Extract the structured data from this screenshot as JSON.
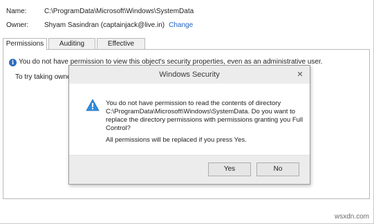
{
  "properties": {
    "name_label": "Name:",
    "name_value": "C:\\ProgramData\\Microsoft\\Windows\\SystemData",
    "owner_label": "Owner:",
    "owner_value": "Shyam Sasindran (captainjack@live.in)",
    "change_link": "Change"
  },
  "tabs": [
    {
      "label": "Permissions",
      "active": true
    },
    {
      "label": "Auditing",
      "active": false
    },
    {
      "label": "Effective Access",
      "active": false
    }
  ],
  "panel": {
    "info_icon": "info-icon",
    "info_text": "You do not have permission to view this object's security properties, even as an administrative user.",
    "ownership_text": "To try taking ownership"
  },
  "dialog": {
    "title": "Windows Security",
    "close_glyph": "✕",
    "warning_icon": "warning-icon",
    "message_lines": [
      "You do not have permission to read the contents of directory",
      "C:\\ProgramData\\Microsoft\\Windows\\SystemData. Do you want to",
      "replace the directory permissions with permissions granting you Full",
      "Control?"
    ],
    "message2": "All permissions will be replaced if you press Yes.",
    "yes_label": "Yes",
    "no_label": "No"
  },
  "watermark": "wsxdn.com",
  "colors": {
    "link": "#1c5fc2",
    "info_icon": "#2d6cc0",
    "warning": "#2f8fe0"
  }
}
